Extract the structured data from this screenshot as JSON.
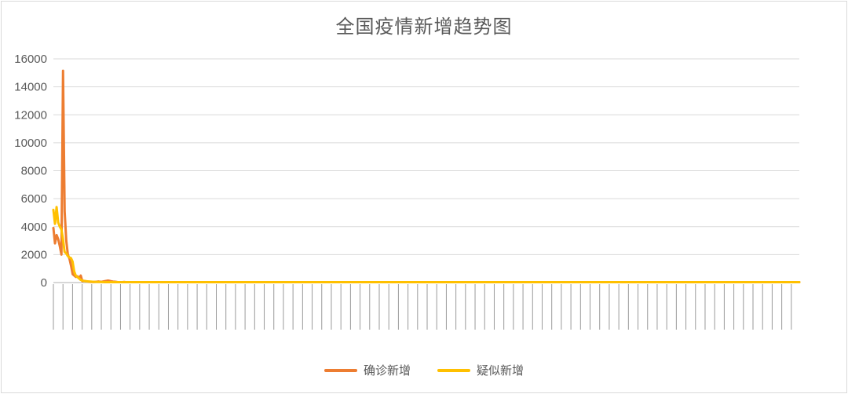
{
  "chart_data": {
    "type": "line",
    "title": "全国疫情新增趋势图",
    "xlabel": "",
    "ylabel": "",
    "ylim": [
      0,
      16000
    ],
    "yticks": [
      "0",
      "2000",
      "4000",
      "6000",
      "8000",
      "10000",
      "12000",
      "14000",
      "16000"
    ],
    "grid": true,
    "legend_position": "bottom",
    "series": [
      {
        "name": "确诊新增",
        "color": "#ED7D31",
        "values": [
          3900,
          2800,
          3400,
          3100,
          2600,
          2000,
          15150,
          5100,
          3000,
          2000,
          1700,
          1200,
          600,
          500,
          400,
          450,
          300,
          500,
          100,
          120,
          100,
          80,
          60,
          50,
          40,
          40,
          50,
          60,
          80,
          60,
          50,
          80,
          100,
          120,
          140,
          120,
          90,
          70,
          60,
          50,
          30,
          30,
          30,
          30,
          40,
          30,
          30,
          30,
          30,
          30,
          30,
          30,
          30,
          30,
          30,
          30,
          30,
          30,
          30,
          30,
          30,
          30,
          30,
          30,
          30,
          30,
          30,
          30,
          30,
          30,
          30,
          30,
          30,
          30,
          30,
          30,
          30,
          30,
          30,
          30,
          30,
          30,
          30,
          30,
          30,
          30,
          30,
          30,
          30,
          30,
          30,
          30,
          30,
          30,
          30,
          30,
          30,
          30,
          30,
          30,
          30,
          30,
          30,
          30,
          30,
          30,
          30,
          30,
          30,
          30,
          30,
          30,
          30,
          30,
          30,
          30,
          30,
          30,
          30,
          30,
          30,
          30,
          30,
          30,
          30,
          30,
          30,
          30,
          30,
          30,
          30,
          30,
          30,
          30,
          30,
          30,
          30,
          30,
          30,
          30,
          30,
          30,
          30,
          30,
          30,
          30,
          30,
          30,
          30,
          30,
          30,
          30,
          30,
          30,
          30,
          30,
          30,
          30,
          30,
          30,
          30,
          30,
          30,
          30,
          30,
          30,
          30,
          30,
          30,
          30,
          30,
          30,
          30,
          30,
          30,
          30,
          30,
          30,
          30,
          30,
          30,
          30,
          30,
          30,
          30,
          30,
          30,
          30,
          30,
          30,
          30,
          30,
          30,
          30,
          30,
          30,
          30,
          30,
          30,
          30,
          30,
          30,
          30,
          30,
          30,
          30,
          30,
          30,
          30,
          30,
          30,
          30,
          30,
          30,
          30,
          30,
          30,
          30,
          30,
          30,
          30,
          30,
          30,
          30,
          30,
          30,
          30,
          30,
          30,
          30,
          30,
          30,
          30,
          30,
          30,
          30,
          30,
          30,
          30,
          30,
          30,
          30,
          30,
          30,
          30,
          30,
          30,
          30,
          30,
          30,
          30,
          30,
          30,
          30,
          30,
          30,
          30,
          30,
          30,
          30,
          30,
          30,
          30,
          30,
          30,
          30,
          30,
          30,
          30,
          30,
          30,
          30,
          30,
          30,
          30,
          30,
          30,
          30,
          30,
          30,
          30,
          30,
          30,
          30,
          30,
          30,
          30,
          30,
          30,
          30,
          30,
          30,
          30,
          30,
          30,
          30,
          30,
          30,
          30,
          30,
          30,
          30,
          30,
          30,
          30,
          30,
          30,
          30,
          30,
          30,
          30,
          30,
          30,
          30,
          30,
          30,
          30,
          30,
          30,
          30,
          30,
          30,
          30,
          30,
          30,
          30,
          30,
          30,
          30,
          30,
          30,
          30,
          30,
          30,
          30,
          30,
          30,
          30,
          30,
          30,
          30,
          30,
          30,
          30,
          30,
          30,
          30,
          30,
          30,
          30,
          30,
          30,
          30,
          30,
          30,
          30,
          30,
          30,
          30,
          30,
          30,
          30,
          30,
          30,
          30,
          30,
          30,
          30,
          30,
          30,
          30,
          30,
          30,
          30,
          30,
          30,
          30,
          30,
          30,
          30,
          30,
          30,
          30,
          30,
          30,
          30,
          30,
          30,
          30,
          30,
          30,
          30,
          30,
          30,
          30,
          30,
          30,
          30,
          30,
          30,
          30,
          30,
          30,
          30,
          30,
          30,
          30,
          30,
          30,
          30,
          30,
          30,
          30,
          30,
          30,
          30,
          30,
          30,
          30,
          30,
          30,
          30,
          30,
          30,
          30,
          30,
          30,
          30,
          30,
          30,
          30,
          30,
          30,
          30,
          30,
          30,
          30,
          30,
          30,
          30,
          30,
          30,
          30,
          30,
          30,
          30,
          30,
          30,
          30,
          30,
          30,
          30,
          30,
          30,
          30,
          30,
          30,
          30,
          30,
          30,
          30,
          30,
          30,
          30,
          30
        ]
      },
      {
        "name": "疑似新增",
        "color": "#FFC000",
        "values": [
          5200,
          4200,
          5400,
          4300,
          4000,
          3800,
          3100,
          2200,
          2100,
          1900,
          1800,
          1750,
          1500,
          800,
          500,
          400,
          300,
          200,
          150,
          120,
          100,
          90,
          80,
          70,
          60,
          50,
          50,
          45,
          40,
          40,
          35,
          35,
          30,
          30,
          30,
          30,
          30,
          30,
          30,
          30,
          30,
          30,
          30,
          30,
          30,
          30,
          30,
          30,
          30,
          30,
          30,
          30,
          30,
          30,
          30,
          30,
          30,
          30,
          30,
          30,
          30,
          30,
          30,
          30,
          30,
          30,
          30,
          30,
          30,
          30,
          30,
          30,
          30,
          30,
          30,
          30,
          30,
          30,
          30,
          30,
          30,
          30,
          30,
          30,
          30,
          30,
          30,
          30,
          30,
          30,
          30,
          30,
          30,
          30,
          30,
          30,
          30,
          30,
          30,
          30,
          30,
          30,
          30,
          30,
          30,
          30,
          30,
          30,
          30,
          30,
          30,
          30,
          30,
          30,
          30,
          30,
          30,
          30,
          30,
          30,
          30,
          30,
          30,
          30,
          30,
          30,
          30,
          30,
          30,
          30,
          30,
          30,
          30,
          30,
          30,
          30,
          30,
          30,
          30,
          30,
          30,
          30,
          30,
          30,
          30,
          30,
          30,
          30,
          30,
          30,
          30,
          30,
          30,
          30,
          30,
          30,
          30,
          30,
          30,
          30,
          30,
          30,
          30,
          30,
          30,
          30,
          30,
          30,
          30,
          30,
          30,
          30,
          30,
          30,
          30,
          30,
          30,
          30,
          30,
          30,
          30,
          30,
          30,
          30,
          30,
          30,
          30,
          30,
          30,
          30,
          30,
          30,
          30,
          30,
          30,
          30,
          30,
          30,
          30,
          30,
          30,
          30,
          30,
          30,
          30,
          30,
          30,
          30,
          30,
          30,
          30,
          30,
          30,
          30,
          30,
          30,
          30,
          30,
          30,
          30,
          30,
          30,
          30,
          30,
          30,
          30,
          30,
          30,
          30,
          30,
          30,
          30,
          30,
          30,
          30,
          30,
          30,
          30,
          30,
          30,
          30,
          30,
          30,
          30,
          30,
          30,
          30,
          30,
          30,
          30,
          30,
          30,
          30,
          30,
          30,
          30,
          30,
          30,
          30,
          30,
          30,
          30,
          30,
          30,
          30,
          30,
          30,
          30,
          30,
          30,
          30,
          30,
          30,
          30,
          30,
          30,
          30,
          30,
          30,
          30,
          30,
          30,
          30,
          30,
          30,
          30,
          30,
          30,
          30,
          30,
          30,
          30,
          30,
          30,
          30,
          30,
          30,
          30,
          30,
          30,
          30,
          30,
          30,
          30,
          30,
          30,
          30,
          30,
          30,
          30,
          30,
          30,
          30,
          30,
          30,
          30,
          30,
          30,
          30,
          30,
          30,
          30,
          30,
          30,
          30,
          30,
          30,
          30,
          30,
          30,
          30,
          30,
          30,
          30,
          30,
          30,
          30,
          30,
          30,
          30,
          30,
          30,
          30,
          30,
          30,
          30,
          30,
          30,
          30,
          30,
          30,
          30,
          30,
          30,
          30,
          30,
          30,
          30,
          30,
          30,
          30,
          30,
          30,
          30,
          30,
          30,
          30,
          30,
          30,
          30,
          30,
          30,
          30,
          30,
          30,
          30,
          30,
          30,
          30,
          30,
          30,
          30,
          30,
          30,
          30,
          30,
          30,
          30,
          30,
          30,
          30,
          30,
          30,
          30,
          30,
          30,
          30,
          30,
          30,
          30,
          30,
          30,
          30,
          30,
          30,
          30,
          30,
          30,
          30,
          30,
          30,
          30,
          30,
          30,
          30,
          30,
          30,
          30,
          30,
          30,
          30,
          30,
          30,
          30,
          30,
          30,
          30,
          30,
          30,
          30,
          30,
          30,
          30,
          30,
          30,
          30,
          30,
          30,
          30,
          30,
          30,
          30,
          30,
          30,
          30,
          30,
          30,
          30,
          30,
          30,
          30,
          30,
          30,
          30,
          30,
          30,
          30,
          30,
          30,
          30,
          30,
          30,
          30,
          30,
          30,
          30,
          30,
          30
        ]
      }
    ]
  }
}
